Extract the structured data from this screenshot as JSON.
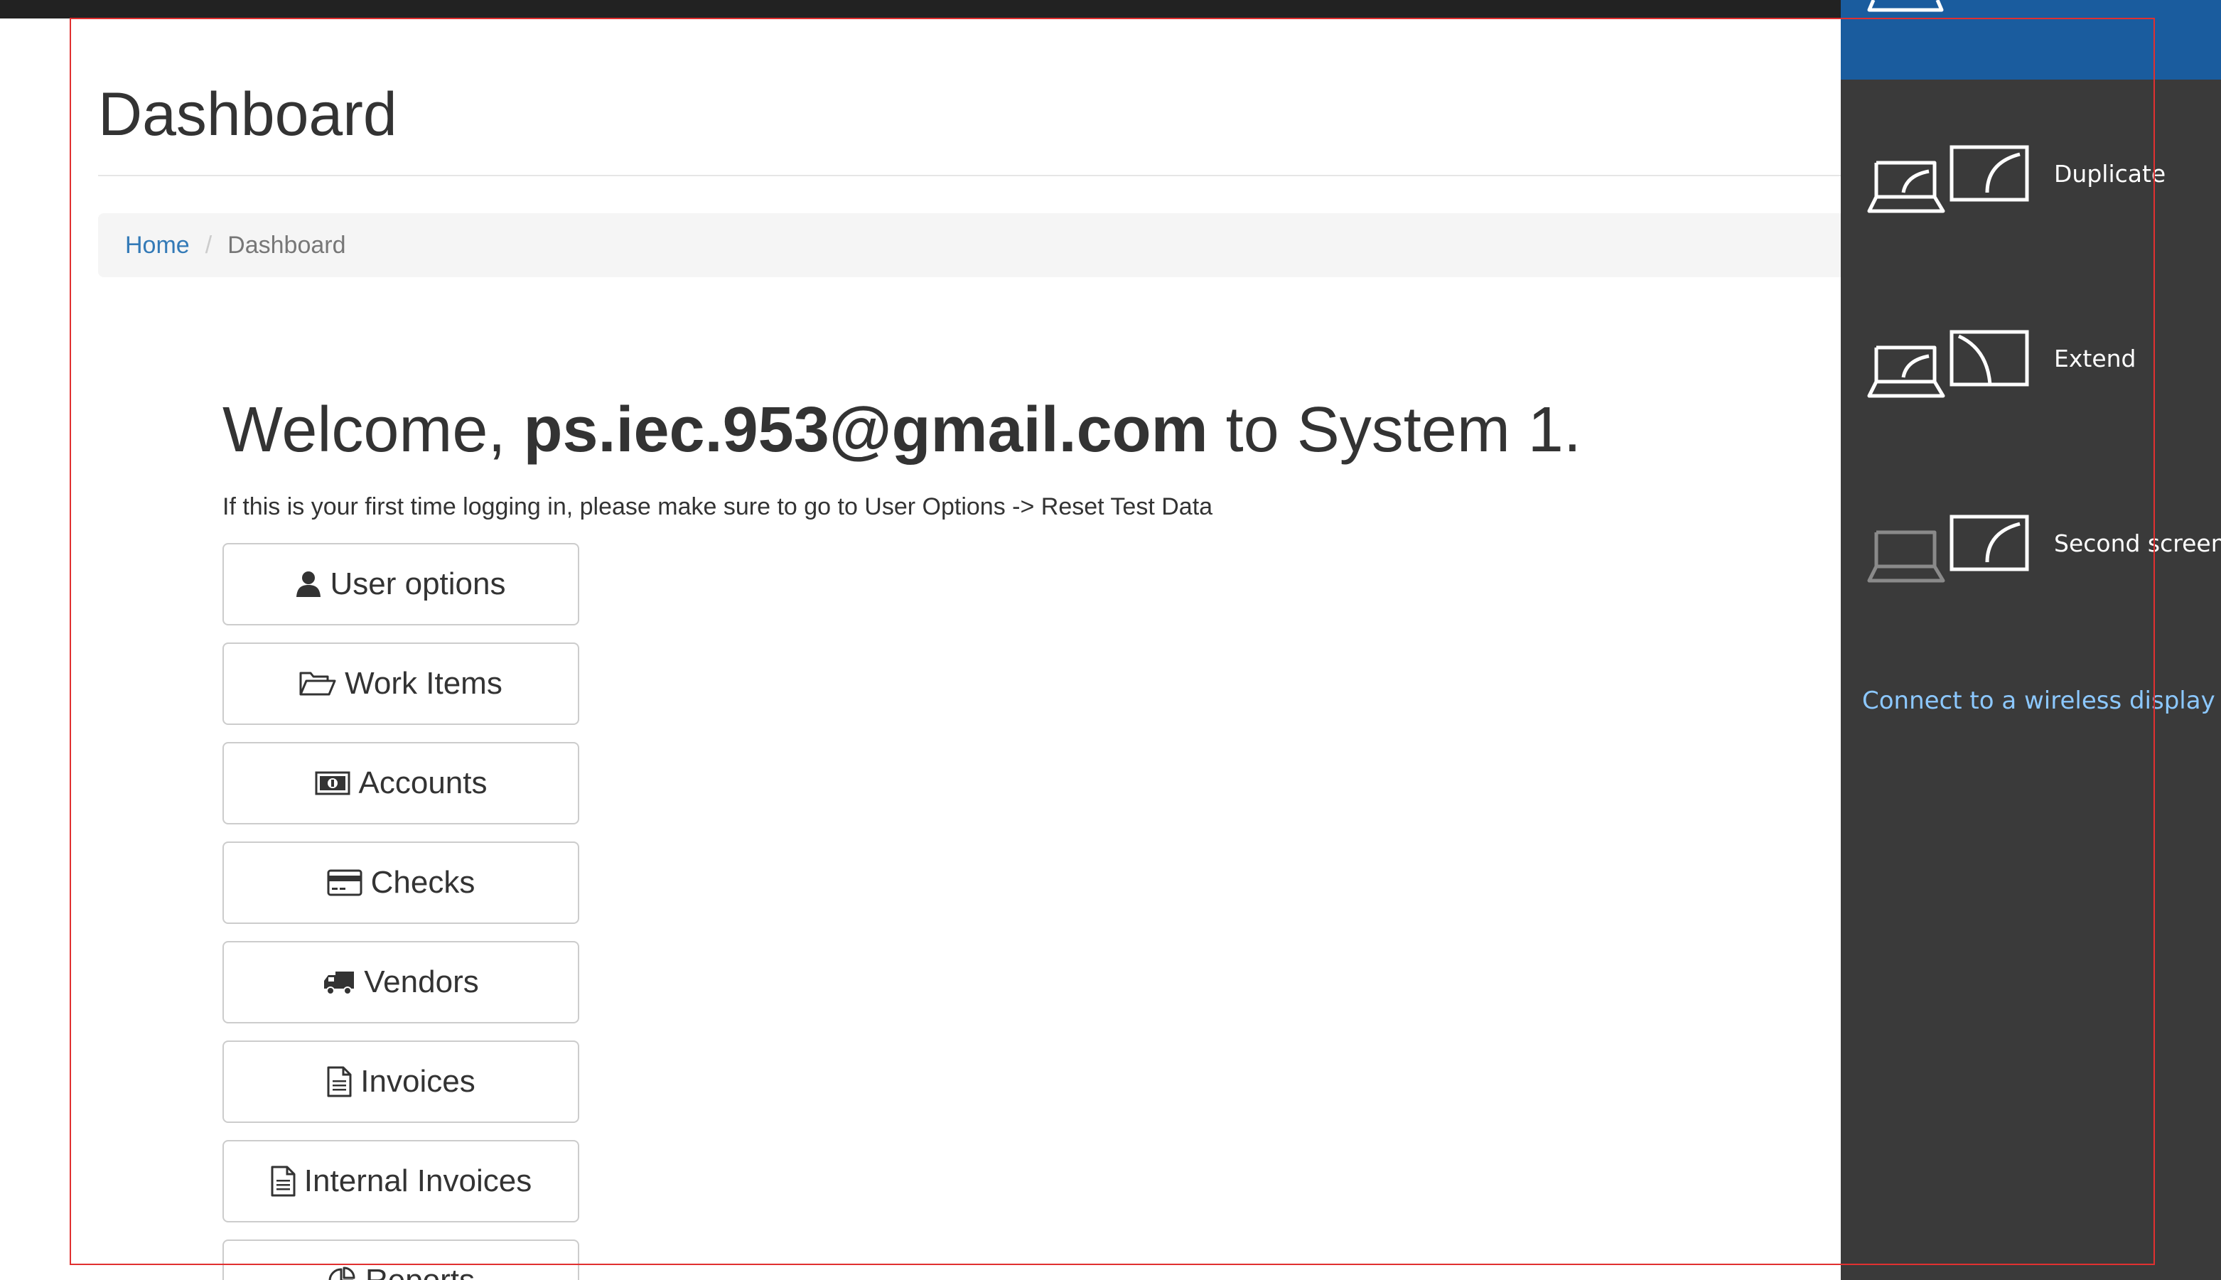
{
  "page": {
    "title": "Dashboard"
  },
  "breadcrumb": {
    "home": "Home",
    "separator": "/",
    "current": "Dashboard"
  },
  "welcome": {
    "prefix": "Welcome, ",
    "email": "ps.iec.953@gmail.com",
    "suffix": " to System 1.",
    "notice": "If this is your first time logging in, please make sure to go to User Options -> Reset Test Data"
  },
  "buttons": [
    {
      "label": "User options",
      "icon": "user-icon"
    },
    {
      "label": "Work Items",
      "icon": "folder-open-icon"
    },
    {
      "label": "Accounts",
      "icon": "money-icon"
    },
    {
      "label": "Checks",
      "icon": "credit-card-icon"
    },
    {
      "label": "Vendors",
      "icon": "truck-icon"
    },
    {
      "label": "Invoices",
      "icon": "file-text-icon"
    },
    {
      "label": "Internal Invoices",
      "icon": "file-text-icon"
    },
    {
      "label": "Reports",
      "icon": "chart-icon"
    }
  ],
  "project_panel": {
    "options": [
      {
        "label": "Duplicate",
        "icon": "duplicate-display-icon"
      },
      {
        "label": "Extend",
        "icon": "extend-display-icon"
      },
      {
        "label": "Second screen o",
        "icon": "second-screen-only-icon"
      }
    ],
    "wireless_link": "Connect to a wireless display"
  },
  "colors": {
    "link": "#337ab7",
    "panel_background": "#3a3a3a",
    "panel_selected": "#1a5c9e",
    "wireless_link": "#8cc8ff",
    "selection_frame": "#e03030"
  }
}
